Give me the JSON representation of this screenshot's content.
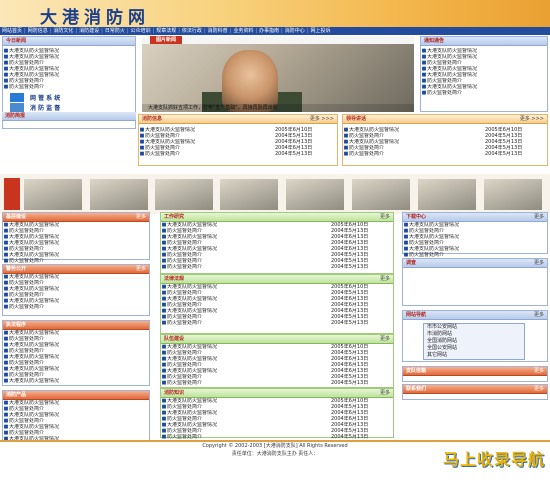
{
  "site": {
    "title": "大港消防网"
  },
  "nav": [
    "网站首页",
    "网防信息",
    "消防文化",
    "消防建设",
    "日常防火",
    "公众培训",
    "规章法规",
    "依法行政",
    "消防科普",
    "业务资料",
    "办事指南",
    "消防中心",
    "网上投诉"
  ],
  "col_left": {
    "today": {
      "title": "今日新闻",
      "items": [
        "大港支队防火监督情况",
        "大港支队防火监督情况",
        "防火监督处简介",
        "大港支队防火监督情况",
        "大港支队防火监督情况",
        "防火监督处简介",
        "防火监督处简介"
      ]
    },
    "sys_links": [
      {
        "label": "网 管 系 统"
      },
      {
        "label": "消 防 监 督"
      }
    ],
    "fire_news": {
      "title": "消防简报"
    }
  },
  "photo": {
    "badge": "图片新闻",
    "caption": "大港支队抓好五项工作，打牢\"五个基础\"，再接再励再出新"
  },
  "notice": {
    "title": "通知通告",
    "items": [
      "大港支队防火监督情况",
      "大港支队防火监督情况",
      "防火监督处简介",
      "大港支队防火监督情况",
      "大港支队防火监督情况",
      "防火监督处简介",
      "大港支队防火监督情况",
      "防火监督处简介"
    ]
  },
  "fire_info": {
    "title": "消防信息",
    "more": "更多 >>>",
    "items": [
      {
        "t": "大港支队防火监督情况",
        "d": "2005年6月10日"
      },
      {
        "t": "防火监督处简介",
        "d": "2004年5月13日"
      },
      {
        "t": "大港支队防火监督情况",
        "d": "2004年6月13日"
      },
      {
        "t": "防火监督处简介",
        "d": "2004年6月13日"
      },
      {
        "t": "防火监督处简介",
        "d": "2004年5月13日"
      }
    ]
  },
  "leader": {
    "title": "领导讲话",
    "more": "更多 >>>",
    "items": [
      {
        "t": "大港支队防火监督情况",
        "d": "2005年6月10日"
      },
      {
        "t": "防火监督处简介",
        "d": "2004年5月13日"
      },
      {
        "t": "大港支队防火监督情况",
        "d": "2004年5月13日"
      },
      {
        "t": "防火监督处简介",
        "d": "2004年5月13日"
      },
      {
        "t": "防火监督处简介",
        "d": "2004年5月13日"
      }
    ]
  },
  "left_lower": [
    {
      "title": "基层建设",
      "more": "更多",
      "items": [
        "大港支队防火监督情况",
        "防火监督处简介",
        "大港支队防火监督情况",
        "大港支队防火监督情况",
        "防火监督处简介",
        "大港支队防火监督情况",
        "防火监督处简介"
      ]
    },
    {
      "title": "警务公开",
      "more": "更多",
      "items": [
        "大港支队防火监督情况",
        "防火监督处简介",
        "大港支队防火监督情况",
        "防火监督处简介",
        "大港支队防火监督情况",
        "防火监督处简介"
      ]
    },
    {
      "title": "执法程序",
      "more": "",
      "items": [
        "大港支队防火监督情况",
        "防火监督处简介",
        "大港支队防火监督情况",
        "防火监督处简介",
        "大港支队防火监督情况",
        "防火监督处简介",
        "大港支队防火监督情况",
        "防火监督处简介",
        "大港支队防火监督情况"
      ]
    },
    {
      "title": "消防产品",
      "more": "",
      "items": [
        "大港支队防火监督情况",
        "防火监督处简介",
        "大港支队防火监督情况",
        "防火监督处简介",
        "大港支队防火监督情况",
        "防火监督处简介",
        "大港支队防火监督情况"
      ]
    }
  ],
  "center_lower": [
    {
      "title": "工作研究",
      "more": "更多",
      "items": [
        {
          "t": "大港支队防火监督情况",
          "d": "2005年6月10日"
        },
        {
          "t": "防火监督处简介",
          "d": "2004年5月13日"
        },
        {
          "t": "大港支队防火监督情况",
          "d": "2004年6月13日"
        },
        {
          "t": "防火监督处简介",
          "d": "2004年6月13日"
        },
        {
          "t": "大港支队防火监督情况",
          "d": "2004年6月13日"
        },
        {
          "t": "防火监督处简介",
          "d": "2004年5月13日"
        },
        {
          "t": "防火监督处简介",
          "d": "2004年5月13日"
        },
        {
          "t": "防火监督处简介",
          "d": "2004年5月13日"
        }
      ]
    },
    {
      "title": "法律法规",
      "more": "更多",
      "items": [
        {
          "t": "大港支队防火监督情况",
          "d": "2005年6月10日"
        },
        {
          "t": "防火监督处简介",
          "d": "2004年5月13日"
        },
        {
          "t": "大港支队防火监督情况",
          "d": "2004年6月13日"
        },
        {
          "t": "防火监督处简介",
          "d": "2004年6月13日"
        },
        {
          "t": "大港支队防火监督情况",
          "d": "2004年6月13日"
        },
        {
          "t": "防火监督处简介",
          "d": "2004年5月13日"
        },
        {
          "t": "防火监督处简介",
          "d": "2004年5月13日"
        }
      ]
    },
    {
      "title": "队伍建设",
      "more": "更多",
      "items": [
        {
          "t": "大港支队防火监督情况",
          "d": "2005年6月10日"
        },
        {
          "t": "防火监督处简介",
          "d": "2004年5月13日"
        },
        {
          "t": "大港支队防火监督情况",
          "d": "2004年6月13日"
        },
        {
          "t": "防火监督处简介",
          "d": "2004年6月13日"
        },
        {
          "t": "大港支队防火监督情况",
          "d": "2004年6月13日"
        },
        {
          "t": "防火监督处简介",
          "d": "2004年5月13日"
        },
        {
          "t": "防火监督处简介",
          "d": "2004年5月13日"
        }
      ]
    },
    {
      "title": "消防知识",
      "more": "更多",
      "items": [
        {
          "t": "大港支队防火监督情况",
          "d": "2005年6月10日"
        },
        {
          "t": "防火监督处简介",
          "d": "2004年5月13日"
        },
        {
          "t": "大港支队防火监督情况",
          "d": "2004年6月13日"
        },
        {
          "t": "防火监督处简介",
          "d": "2004年6月13日"
        },
        {
          "t": "大港支队防火监督情况",
          "d": "2004年6月13日"
        },
        {
          "t": "防火监督处简介",
          "d": "2004年5月13日"
        },
        {
          "t": "防火监督处简介",
          "d": "2004年5月13日"
        }
      ]
    }
  ],
  "right_lower": {
    "download": {
      "title": "下载中心",
      "more": "更多",
      "items": [
        "大港支队防火监督情况",
        "防火监督处简介",
        "大港支队防火监督情况",
        "防火监督处简介",
        "大港支队防火监督情况",
        "防火监督处简介"
      ]
    },
    "survey": {
      "title": "调查",
      "more": "更多"
    },
    "links": {
      "title": "网站导航",
      "more": "更多",
      "options": [
        "市市公安网站",
        "市消防网站",
        "全国消防网站",
        "全国公安网站",
        "其它网站"
      ]
    },
    "mailbox": {
      "title": "支队信箱",
      "more": "更多"
    },
    "contact": {
      "title": "联系我们",
      "more": "更多"
    }
  },
  "footer": {
    "copyright": "Copyright © 2002-2003 [大港消防支队] All Rights Reserved",
    "unit": "责任单位：大港消防支队主办   责任人："
  },
  "watermark": "马上收录导航"
}
